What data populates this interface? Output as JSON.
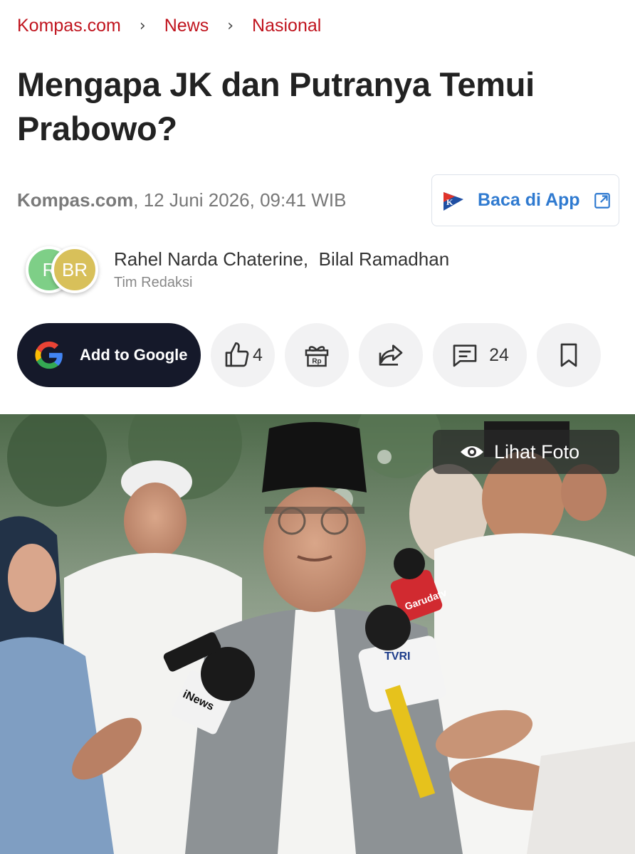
{
  "breadcrumb": {
    "items": [
      "Kompas.com",
      "News",
      "Nasional"
    ],
    "separator": "›"
  },
  "article": {
    "title": "Mengapa JK dan Putranya Temui Prabowo?",
    "source": "Kompas.com",
    "datetime": ", 12 Juni 2026, 09:41 WIB"
  },
  "app_button": {
    "label": "Baca di App",
    "logo_letter": "K"
  },
  "authors": {
    "avatars": [
      "R",
      "BR"
    ],
    "names": "Rahel Narda Chaterine,  Bilal Ramadhan",
    "role": "Tim Redaksi"
  },
  "actions": {
    "google_label": "Add to Google",
    "like_count": "4",
    "comment_count": "24",
    "gift_label": "Rp"
  },
  "photo": {
    "view_label": "Lihat Foto",
    "mic_labels": [
      "iNews",
      "TVRI",
      "Garudatv"
    ]
  },
  "colors": {
    "brand_red": "#c0141e",
    "link_blue": "#2f7ad0",
    "google_btn_bg": "#15192a",
    "pill_bg": "#f2f2f3"
  },
  "icons": [
    "chevron-right-icon",
    "kompas-logo-icon",
    "external-link-icon",
    "google-logo-icon",
    "thumbs-up-icon",
    "gift-icon",
    "share-icon",
    "comment-icon",
    "bookmark-icon",
    "eye-icon"
  ]
}
